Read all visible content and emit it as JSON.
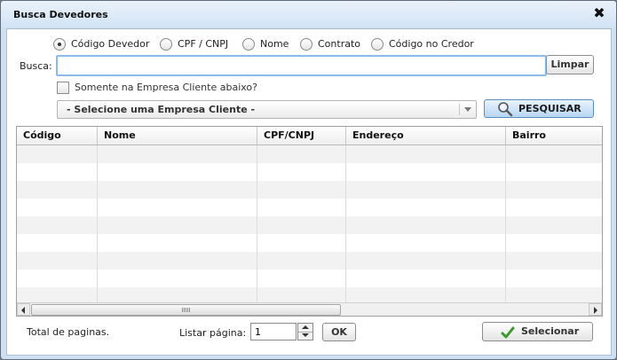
{
  "window": {
    "title": "Busca Devedores",
    "close_glyph": "✖"
  },
  "search_type": {
    "options": [
      {
        "label": "Código Devedor",
        "checked": true
      },
      {
        "label": "CPF / CNPJ",
        "checked": false
      },
      {
        "label": "Nome",
        "checked": false
      },
      {
        "label": "Contrato",
        "checked": false
      },
      {
        "label": "Código no Credor",
        "checked": false
      }
    ]
  },
  "search": {
    "label": "Busca:",
    "value": "",
    "clear_label": "Limpar"
  },
  "filter": {
    "checkbox_label": "Somente na Empresa Cliente abaixo?",
    "checked": false
  },
  "company_select": {
    "selected": "- Selecione uma Empresa Cliente -"
  },
  "search_button": {
    "label": "PESQUISAR",
    "icon": "magnifier-icon"
  },
  "grid": {
    "columns": [
      "Código",
      "Nome",
      "CPF/CNPJ",
      "Endereço",
      "Bairro"
    ],
    "rows": []
  },
  "footer": {
    "total_label": "Total de paginas.",
    "page_label": "Listar página:",
    "page_value": "1",
    "ok_label": "OK",
    "select_label": "Selecionar"
  },
  "colors": {
    "accent_border": "#8ebce8",
    "title_bg": "#d2e3f4",
    "check_green": "#3a9a2a"
  }
}
